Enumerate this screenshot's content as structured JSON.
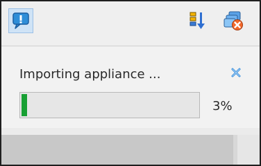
{
  "toolbar": {
    "icons": {
      "messages": "message-bubble-icon",
      "sort": "sort-down-icon",
      "dismiss_all": "dismiss-all-icon"
    }
  },
  "notification": {
    "title": "Importing appliance ...",
    "progress_fraction": 0.03,
    "progress_text": "3%",
    "cancel_icon": "close-x-icon"
  },
  "colors": {
    "progress": "#18a033",
    "accent_blue": "#1e88e5"
  }
}
